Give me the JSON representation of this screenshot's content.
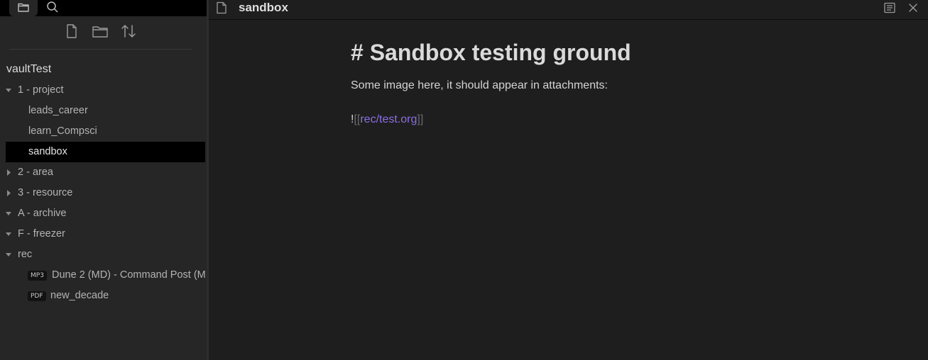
{
  "sidebar": {
    "vault_name": "vaultTest",
    "tree": [
      {
        "type": "folder",
        "label": "1 - project",
        "expanded": true
      },
      {
        "type": "file",
        "label": "leads_career"
      },
      {
        "type": "file",
        "label": "learn_Compsci"
      },
      {
        "type": "file",
        "label": "sandbox",
        "active": true
      },
      {
        "type": "folder",
        "label": "2 - area",
        "expanded": false
      },
      {
        "type": "folder",
        "label": "3 - resource",
        "expanded": false
      },
      {
        "type": "folder",
        "label": "A - archive",
        "expanded": true
      },
      {
        "type": "folder",
        "label": "F - freezer",
        "expanded": true
      },
      {
        "type": "folder",
        "label": "rec",
        "expanded": true
      },
      {
        "type": "attachment",
        "badge": "MP3",
        "label": "Dune 2 (MD) - Command Post (M"
      },
      {
        "type": "attachment",
        "badge": "PDF",
        "label": "new_decade"
      }
    ]
  },
  "editor": {
    "title": "sandbox",
    "heading": "# Sandbox testing ground",
    "paragraph": "Some image here, it should appear in attachments:",
    "embed": {
      "prefix": "!",
      "open": "[[",
      "link": "rec/test.org",
      "close": "]]"
    }
  },
  "colors": {
    "accent_link": "#8a6fe8",
    "active_item_bg": "#000000",
    "sidebar_bg": "#262626",
    "editor_bg": "#1e1e1e"
  },
  "icons": [
    "folder-icon",
    "search-icon",
    "new-note-icon",
    "new-folder-icon",
    "sort-icon",
    "document-icon",
    "reading-view-icon",
    "close-icon"
  ]
}
